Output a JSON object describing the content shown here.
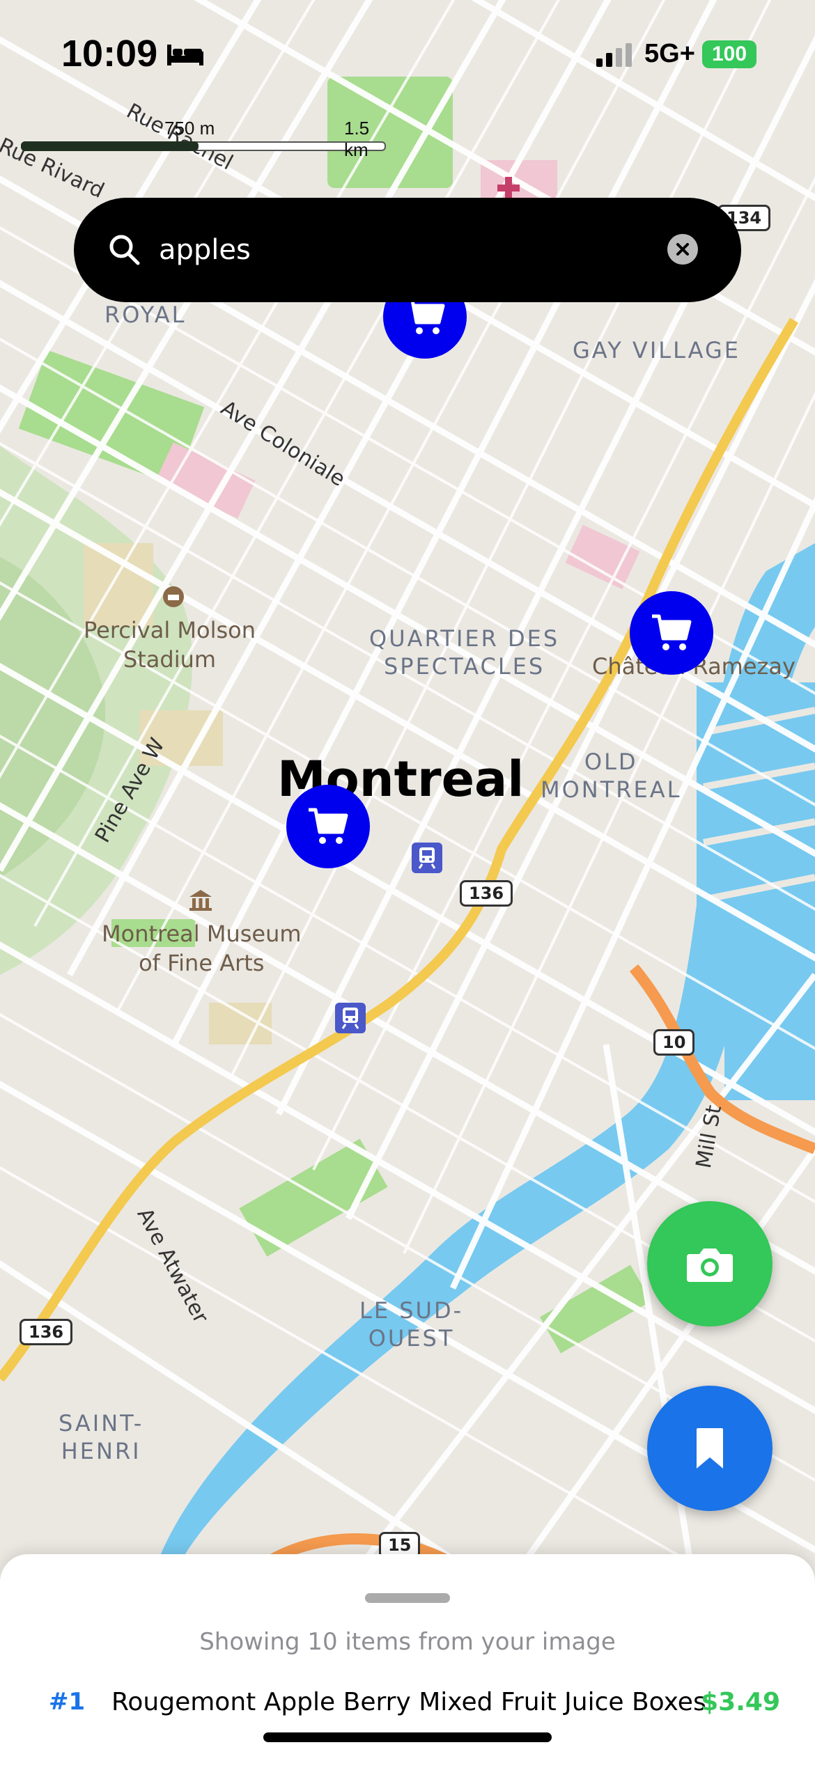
{
  "status_bar": {
    "time": "10:09",
    "sleep_icon": "bed-icon",
    "signal_icon": "cellular-signal-icon",
    "network": "5G+",
    "battery": "100",
    "battery_color": "#34c759"
  },
  "scale_bar": {
    "label_1": "750 m",
    "label_2": "1.5 km"
  },
  "search": {
    "query": "apples",
    "search_icon": "search-icon",
    "clear_icon": "clear-icon",
    "background": "#000000"
  },
  "map": {
    "city": "Montreal",
    "districts": [
      "ROYAL",
      "GAY VILLAGE",
      "QUARTIER DES\nSPECTACLES",
      "OLD\nMONTREAL",
      "LE SUD-\nOUEST",
      "SAINT-\nHENRI"
    ],
    "pois": [
      "Percival Molson\nStadium",
      "Montreal Museum\nof Fine Arts",
      "Château Ramezay"
    ],
    "streets": [
      "Ave Coloniale",
      "Pine Ave W",
      "Ave Atwater",
      "Mill St",
      "Rue Rivard",
      "Rue Rachel"
    ],
    "route_shields": [
      "134",
      "136",
      "136",
      "10",
      "136",
      "15"
    ],
    "pin_icon": "shopping-cart-icon",
    "pin_color": "#0000ee"
  },
  "fabs": {
    "camera_icon": "camera-icon",
    "camera_color": "#34c759",
    "bookmark_icon": "bookmark-icon",
    "bookmark_color": "#1a73e8"
  },
  "results": {
    "caption": "Showing 10 items from your image",
    "items": [
      {
        "rank": "#1",
        "name": "Rougemont Apple Berry Mixed Fruit Juice Boxes",
        "price": "$3.49"
      }
    ]
  }
}
